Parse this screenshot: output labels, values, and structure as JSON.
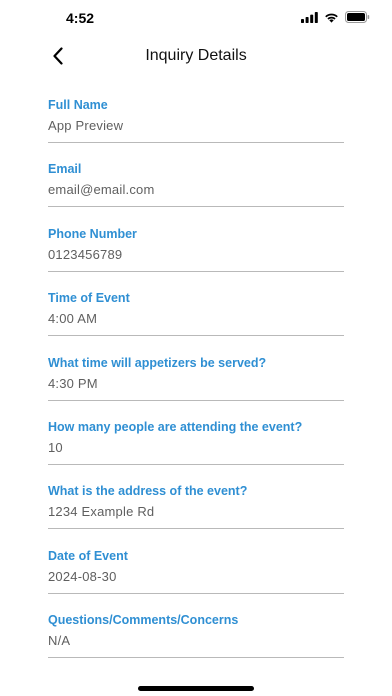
{
  "status_bar": {
    "time": "4:52",
    "icons": [
      "signal-icon",
      "wifi-icon",
      "battery-icon"
    ]
  },
  "nav": {
    "title": "Inquiry Details",
    "back_icon": "chevron-left-icon"
  },
  "fields": [
    {
      "label": "Full Name",
      "value": "App Preview"
    },
    {
      "label": "Email",
      "value": "email@email.com"
    },
    {
      "label": "Phone Number",
      "value": "0123456789"
    },
    {
      "label": "Time of Event",
      "value": "4:00 AM"
    },
    {
      "label": "What time will appetizers be served?",
      "value": "4:30 PM"
    },
    {
      "label": "How many people are attending the event?",
      "value": "10"
    },
    {
      "label": "What is the address of the event?",
      "value": "1234 Example Rd"
    },
    {
      "label": "Date of Event",
      "value": "2024-08-30"
    },
    {
      "label": "Questions/Comments/Concerns",
      "value": "N/A"
    }
  ],
  "colors": {
    "label": "#2f8fd3",
    "value": "#5f5f5f",
    "underline": "#b9b9b9"
  }
}
